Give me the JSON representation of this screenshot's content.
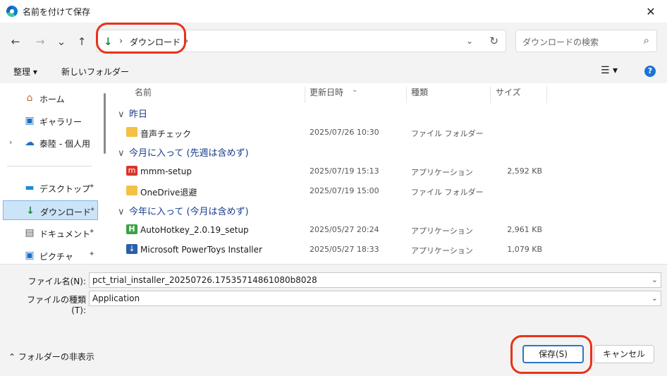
{
  "window": {
    "title": "名前を付けて保存",
    "close_glyph": "✕"
  },
  "nav": {
    "back_glyph": "←",
    "forward_glyph": "→",
    "recent_glyph": "⌄",
    "up_glyph": "↑",
    "address_icon": "download-icon",
    "address_sep": "›",
    "address_crumb": "ダウンロード",
    "address_dd": "⌄",
    "refresh_glyph": "↻",
    "search_placeholder": "ダウンロードの検索",
    "search_glyph": "⌕"
  },
  "toolbar": {
    "organize_label": "整理 ▾",
    "new_folder_label": "新しいフォルダー",
    "view_label": "☰ ▾",
    "help_label": "?"
  },
  "sidebar": {
    "items": [
      {
        "label": "ホーム",
        "icon": "home-icon",
        "glyph": "⌂",
        "pinned": false
      },
      {
        "label": "ギャラリー",
        "icon": "gallery-icon",
        "glyph": "▣",
        "pinned": false
      },
      {
        "label": "泰陸 - 個人用",
        "icon": "cloud-icon",
        "glyph": "☁",
        "pinned": false
      },
      {
        "label": "デスクトップ",
        "icon": "desktop-icon",
        "glyph": "▬",
        "pinned": true
      },
      {
        "label": "ダウンロード",
        "icon": "download-icon",
        "glyph": "↓",
        "pinned": true,
        "selected": true
      },
      {
        "label": "ドキュメント",
        "icon": "document-icon",
        "glyph": "▤",
        "pinned": true
      },
      {
        "label": "ピクチャ",
        "icon": "pictures-icon",
        "glyph": "▣",
        "pinned": true
      }
    ],
    "expand_glyph": "›",
    "pin_glyph": "📌"
  },
  "columns": {
    "name": "名前",
    "date": "更新日時",
    "type": "種類",
    "size": "サイズ",
    "sort_glyph": "⌄"
  },
  "groups": [
    {
      "label": "昨日",
      "files": [
        {
          "name": "音声チェック",
          "date": "2025/07/26 10:30",
          "type": "ファイル フォルダー",
          "size": "",
          "icon": "folder-icon"
        }
      ]
    },
    {
      "label": "今月に入って (先週は含めず)",
      "files": [
        {
          "name": "mmm-setup",
          "date": "2025/07/19 15:13",
          "type": "アプリケーション",
          "size": "2,592 KB",
          "icon": "app-icon"
        },
        {
          "name": "OneDrive退避",
          "date": "2025/07/19 15:00",
          "type": "ファイル フォルダー",
          "size": "",
          "icon": "folder-icon"
        }
      ]
    },
    {
      "label": "今年に入って (今月は含めず)",
      "files": [
        {
          "name": "AutoHotkey_2.0.19_setup",
          "date": "2025/05/27 20:24",
          "type": "アプリケーション",
          "size": "2,961 KB",
          "icon": "autohotkey-icon"
        },
        {
          "name": "Microsoft PowerToys Installer",
          "date": "2025/05/27 18:33",
          "type": "アプリケーション",
          "size": "1,079 KB",
          "icon": "installer-icon"
        }
      ]
    }
  ],
  "group_chev": "∨",
  "form": {
    "filename_label": "ファイル名(N):",
    "filename_value": "pct_trial_installer_20250726.17535714861080b8028",
    "filetype_label": "ファイルの種類(T):",
    "filetype_value": "Application",
    "dd_glyph": "⌄"
  },
  "footer": {
    "hide_folders_label": "⌃ フォルダーの非表示",
    "save_label": "保存(S)",
    "cancel_label": "キャンセル"
  },
  "colors": {
    "accent": "#2b76c9",
    "highlight": "#e8321a",
    "selected_bg": "#cce4f7",
    "group_text": "#1a3e8c"
  }
}
